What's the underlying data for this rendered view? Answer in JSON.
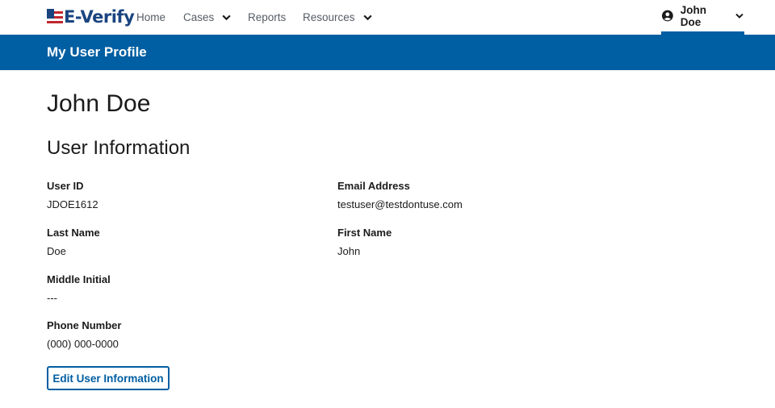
{
  "header": {
    "logo_text": "E-Verify",
    "nav": [
      {
        "label": "Home",
        "has_dropdown": false
      },
      {
        "label": "Cases",
        "has_dropdown": true
      },
      {
        "label": "Reports",
        "has_dropdown": false
      },
      {
        "label": "Resources",
        "has_dropdown": true
      }
    ],
    "user_menu": {
      "name": "John Doe",
      "icon": "user-circle-icon"
    }
  },
  "banner": {
    "title": "My User Profile"
  },
  "profile": {
    "name": "John Doe",
    "section_title": "User Information",
    "fields": {
      "user_id": {
        "label": "User ID",
        "value": "JDOE1612"
      },
      "email": {
        "label": "Email Address",
        "value": "testuser@testdontuse.com"
      },
      "last_name": {
        "label": "Last Name",
        "value": "Doe"
      },
      "first_name": {
        "label": "First Name",
        "value": "John"
      },
      "middle_initial": {
        "label": "Middle Initial",
        "value": "---"
      },
      "phone": {
        "label": "Phone Number",
        "value": "(000) 000-0000"
      }
    },
    "edit_button_label": "Edit User Information"
  },
  "colors": {
    "primary": "#005ea2",
    "logo_blue": "#1a4480",
    "logo_red": "#c0282e",
    "nav_text": "#565c65",
    "text": "#1b1b1b"
  }
}
